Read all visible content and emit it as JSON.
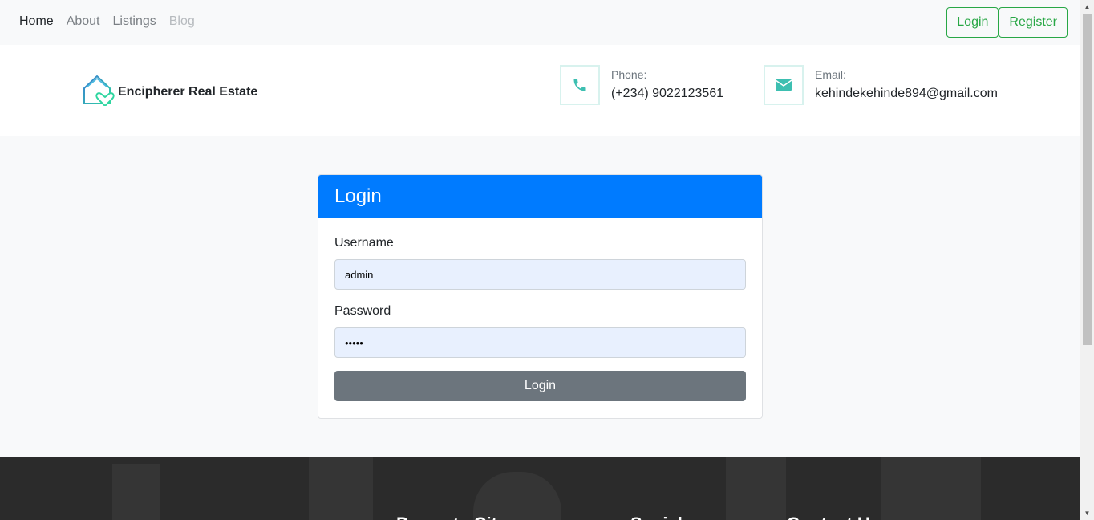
{
  "nav": {
    "links": [
      {
        "label": "Home",
        "state": "active"
      },
      {
        "label": "About",
        "state": "normal"
      },
      {
        "label": "Listings",
        "state": "normal"
      },
      {
        "label": "Blog",
        "state": "disabled"
      }
    ],
    "login_label": "Login",
    "register_label": "Register"
  },
  "header": {
    "brand_name": "Encipherer Real Estate",
    "phone_label": "Phone:",
    "phone_value": "(+234) 9022123561",
    "email_label": "Email:",
    "email_value": "kehindekehinde894@gmail.com"
  },
  "login_card": {
    "title": "Login",
    "username_label": "Username",
    "username_value": "admin",
    "password_label": "Password",
    "password_value": "•••••",
    "submit_label": "Login"
  },
  "footer": {
    "headings": [
      "Property Cit",
      "Social",
      "Contact U"
    ]
  },
  "colors": {
    "accent_blue": "#007bff",
    "success_green": "#28a745",
    "teal_icon": "#3dbfb1",
    "button_gray": "#6c757d"
  },
  "icons": {
    "logo": "house-heart-logo-icon",
    "phone": "phone-icon",
    "email": "envelope-icon"
  }
}
